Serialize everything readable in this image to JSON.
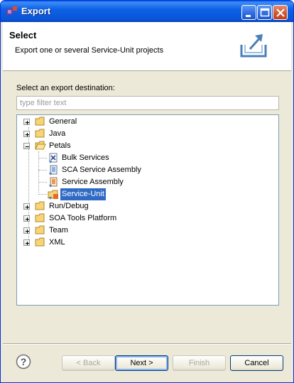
{
  "window": {
    "title": "Export"
  },
  "header": {
    "title": "Select",
    "description": "Export one or several Service-Unit projects",
    "icon": "export-wizard-icon"
  },
  "main": {
    "destination_label": "Select an export destination:",
    "filter_placeholder": "type filter text",
    "filter_value": "",
    "tree": [
      {
        "label": "General",
        "icon": "folder-icon",
        "expanded": false
      },
      {
        "label": "Java",
        "icon": "folder-icon",
        "expanded": false
      },
      {
        "label": "Petals",
        "icon": "folder-open-icon",
        "expanded": true,
        "children": [
          {
            "label": "Bulk Services",
            "icon": "bulk-services-icon"
          },
          {
            "label": "SCA Service Assembly",
            "icon": "sca-assembly-icon"
          },
          {
            "label": "Service Assembly",
            "icon": "service-assembly-icon"
          },
          {
            "label": "Service-Unit",
            "icon": "service-unit-icon",
            "selected": true
          }
        ]
      },
      {
        "label": "Run/Debug",
        "icon": "folder-icon",
        "expanded": false
      },
      {
        "label": "SOA Tools Platform",
        "icon": "folder-icon",
        "expanded": false
      },
      {
        "label": "Team",
        "icon": "folder-icon",
        "expanded": false
      },
      {
        "label": "XML",
        "icon": "folder-icon",
        "expanded": false
      }
    ]
  },
  "footer": {
    "back_label": "< Back",
    "next_label": "Next >",
    "finish_label": "Finish",
    "cancel_label": "Cancel"
  },
  "colors": {
    "titlebar": "#0a55d8",
    "selection": "#316ac5",
    "dialog_bg": "#ece9d8"
  }
}
